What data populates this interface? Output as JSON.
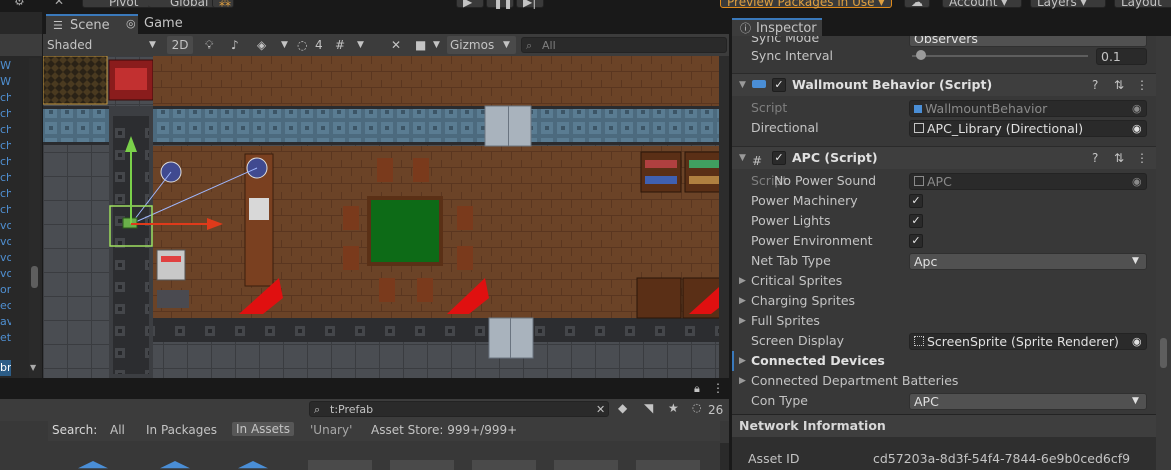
{
  "toolbar": {
    "pivot": "Pivot",
    "global": "Global",
    "preview_packages": "Preview Packages in Use",
    "account": "Account",
    "layers": "Layers",
    "layout": "Layout"
  },
  "hierarchy": {
    "rows": [
      "W",
      "W",
      "ch",
      "ch",
      "ch",
      "ch",
      "ch",
      "ch",
      "ch",
      "ch",
      "vo",
      "vo",
      "vo",
      "vo",
      "or",
      "ec",
      "av",
      "et",
      "br"
    ]
  },
  "scene_tabs": {
    "scene": "Scene",
    "game": "Game"
  },
  "scene_toolbar": {
    "draw_mode": "Shaded",
    "mode_2d": "2D",
    "hidden_count": "4",
    "gizmos": "Gizmos",
    "search_placeholder": "All"
  },
  "inspector": {
    "tab": "Inspector",
    "sync_mode_label": "Sync Mode",
    "sync_mode_value": "Observers",
    "sync_interval_label": "Sync Interval",
    "sync_interval_value": "0.1",
    "sync_interval_fraction": 0.05,
    "wallmount": {
      "title": "Wallmount Behavior (Script)",
      "script_label": "Script",
      "script_value": "WallmountBehavior",
      "directional_label": "Directional",
      "directional_value": "APC_Library (Directional)"
    },
    "apc": {
      "title": "APC (Script)",
      "script_label": "Script",
      "script_value": "APC",
      "no_power_sound_label": "No Power Sound",
      "power_machinery_label": "Power Machinery",
      "power_machinery": true,
      "power_lights_label": "Power Lights",
      "power_lights": true,
      "power_environment_label": "Power Environment",
      "power_environment": true,
      "net_tab_type_label": "Net Tab Type",
      "net_tab_type_value": "Apc",
      "critical_sprites": "Critical Sprites",
      "charging_sprites": "Charging Sprites",
      "full_sprites": "Full Sprites",
      "screen_display_label": "Screen Display",
      "screen_display_value": "ScreenSprite (Sprite Renderer)",
      "connected_devices": "Connected Devices",
      "connected_batteries": "Connected Department Batteries",
      "con_type_label": "Con Type",
      "con_type_value": "APC"
    },
    "network": {
      "title": "Network Information",
      "asset_id_label": "Asset ID",
      "asset_id_value": "cd57203a-8d3f-54f4-7844-6e9b0ced6cf9"
    }
  },
  "project": {
    "search_value": "t:Prefab",
    "hidden_count": "26",
    "search_label": "Search:",
    "filter_all": "All",
    "filter_packages": "In Packages",
    "filter_assets": "In Assets",
    "filter_unary": "'Unary'",
    "asset_store": "Asset Store: 999+/999+"
  },
  "colors": {
    "accent": "#3a79bb",
    "floor": "#6b4327",
    "table": "#0d6b17",
    "selection": "#2c5d87"
  }
}
